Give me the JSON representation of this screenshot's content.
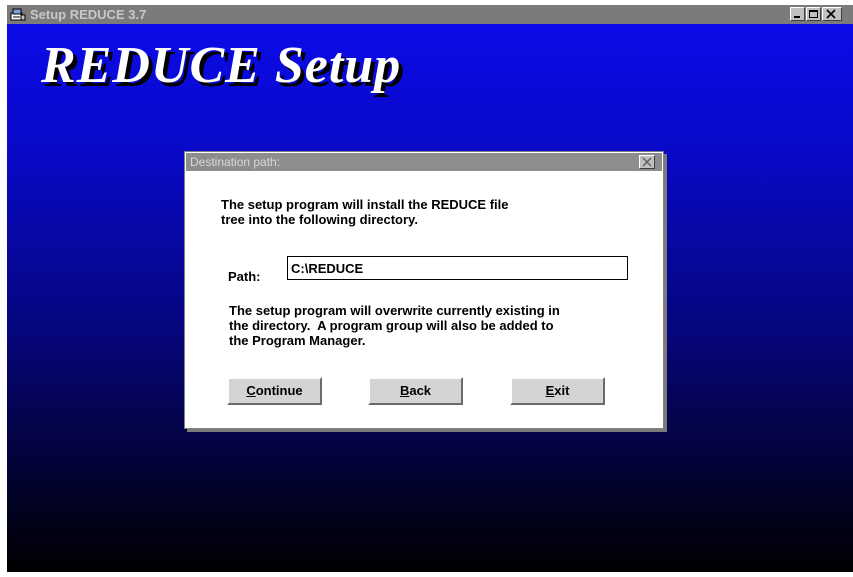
{
  "window": {
    "title": "Setup REDUCE 3.7",
    "heading": "REDUCE Setup"
  },
  "dialog": {
    "title": "Destination path:",
    "intro": "The setup program will install the REDUCE file\ntree into the following directory.",
    "path_label": "Path:",
    "path_value": "C:\\REDUCE",
    "warning": "The setup program will overwrite currently existing in\nthe directory.  A program group will also be added to\nthe Program Manager.",
    "buttons": {
      "continue": {
        "accel": "C",
        "rest": "ontinue"
      },
      "back": {
        "accel": "B",
        "rest": "ack"
      },
      "exit": {
        "accel": "E",
        "rest": "xit"
      }
    }
  },
  "icons": {
    "app": "setup-app-icon",
    "minimize": "minimize-icon",
    "maximize": "maximize-icon",
    "close": "close-icon"
  },
  "colors": {
    "background_top": "#0b0be9",
    "background_bottom": "#000000",
    "titlebar": "#7b7b7b",
    "dialog_titlebar": "#8d8d8d"
  }
}
